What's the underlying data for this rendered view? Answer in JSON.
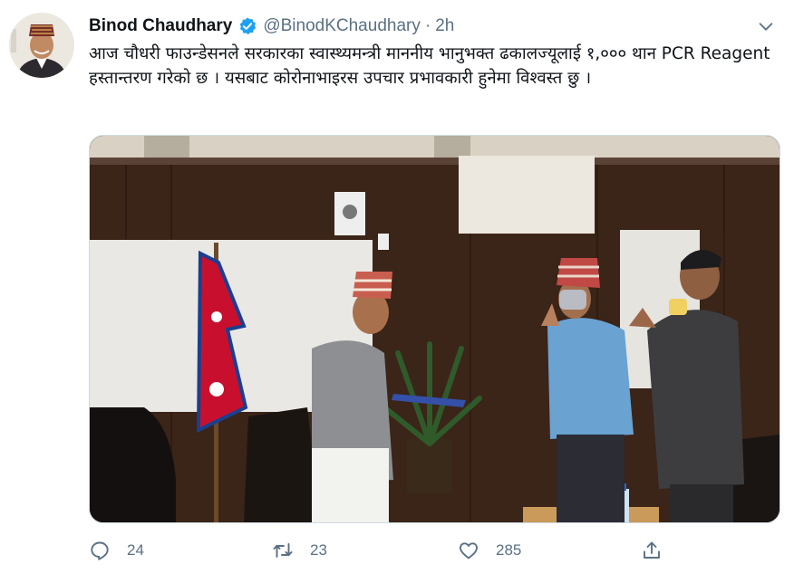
{
  "author": {
    "name": "Binod Chaudhary",
    "handle": "@BinodKChaudhary",
    "separator": "·",
    "time": "2h",
    "verified": true
  },
  "tweet": {
    "text": "आज चौधरी फाउन्डेसनले सरकारका स्वास्थ्यमन्त्री माननीय भानुभक्त ढकालज्यूलाई १,००० थान PCR Reagent हस्तान्तरण गरेको छ । यसबाट कोरोनाभाइरस उपचार प्रभावकारी हुनेमा विश्वस्त छु ।"
  },
  "actions": {
    "reply_count": "24",
    "retweet_count": "23",
    "like_count": "285"
  },
  "colors": {
    "text_primary": "#0f1419",
    "text_secondary": "#5b7083",
    "verified_blue": "#1da1f2",
    "border": "#cfd9de"
  },
  "icons": [
    "verified-badge-icon",
    "chevron-down-icon",
    "reply-icon",
    "retweet-icon",
    "like-icon",
    "share-icon"
  ]
}
